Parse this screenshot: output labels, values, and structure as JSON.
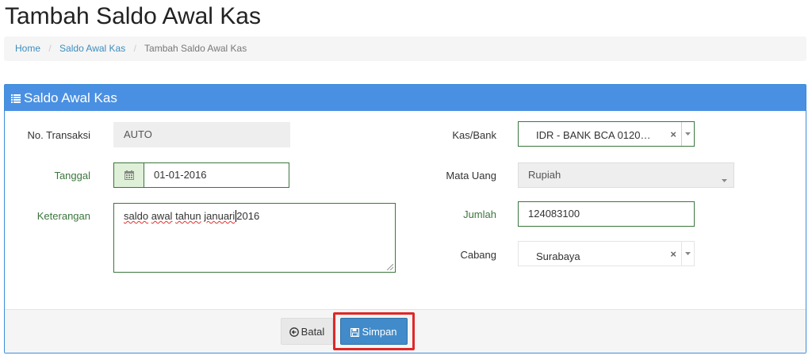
{
  "page": {
    "title": "Tambah Saldo Awal Kas"
  },
  "breadcrumb": {
    "home": "Home",
    "parent": "Saldo Awal Kas",
    "current": "Tambah Saldo Awal Kas",
    "separator": "/"
  },
  "panel": {
    "title": "Saldo Awal Kas",
    "icon": "list-icon"
  },
  "form": {
    "no_transaksi": {
      "label": "No. Transaksi",
      "value": "AUTO"
    },
    "tanggal": {
      "label": "Tanggal",
      "value": "01-01-2016",
      "icon": "calendar-icon"
    },
    "keterangan": {
      "label": "Keterangan",
      "words": [
        "saldo",
        "awal",
        "tahun",
        "januari",
        "2016"
      ]
    },
    "kas_bank": {
      "label": "Kas/Bank",
      "value": "IDR - BANK BCA 0120…",
      "clear": "×"
    },
    "mata_uang": {
      "label": "Mata Uang",
      "value": "Rupiah"
    },
    "jumlah": {
      "label": "Jumlah",
      "value": "124083100"
    },
    "cabang": {
      "label": "Cabang",
      "value": "Surabaya",
      "clear": "×"
    }
  },
  "actions": {
    "cancel": {
      "label": "Batal",
      "icon": "back-circle-icon"
    },
    "save": {
      "label": "Simpan",
      "icon": "floppy-disk-icon"
    }
  },
  "colors": {
    "primary": "#4a90e2",
    "success_border": "#3c763d",
    "highlight": "#e02727"
  }
}
